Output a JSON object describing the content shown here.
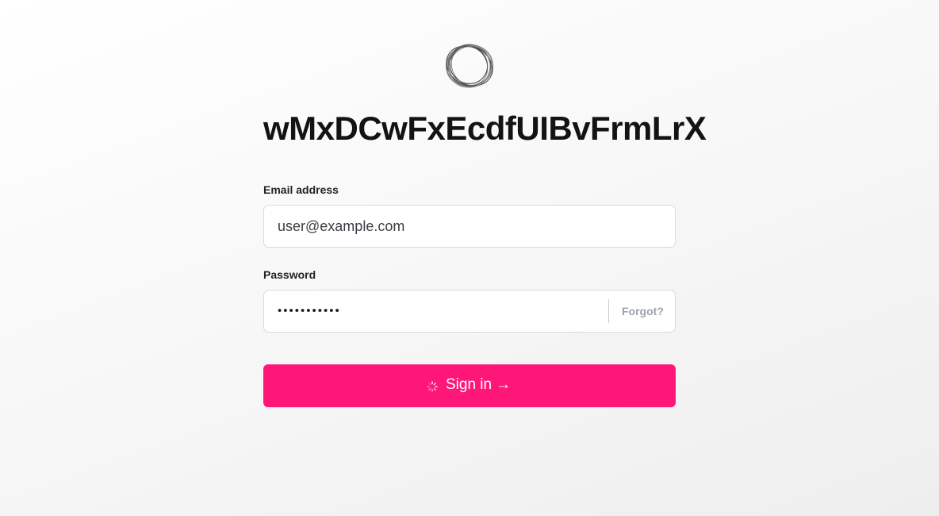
{
  "app": {
    "title": "wMxDCwFxEcdfUIBvFrmLrX",
    "logo_icon": "ring-logo-icon"
  },
  "form": {
    "email": {
      "label": "Email address",
      "value": "user@example.com"
    },
    "password": {
      "label": "Password",
      "masked_value": "•••••••••••",
      "forgot_label": "Forgot?"
    },
    "submit": {
      "label": "Sign in",
      "arrow": "→",
      "spinner_icon": "loading-spinner-icon"
    }
  },
  "colors": {
    "accent": "#ff1679",
    "title": "#111315",
    "muted": "#9ca3af",
    "border": "#d9dbe0"
  }
}
